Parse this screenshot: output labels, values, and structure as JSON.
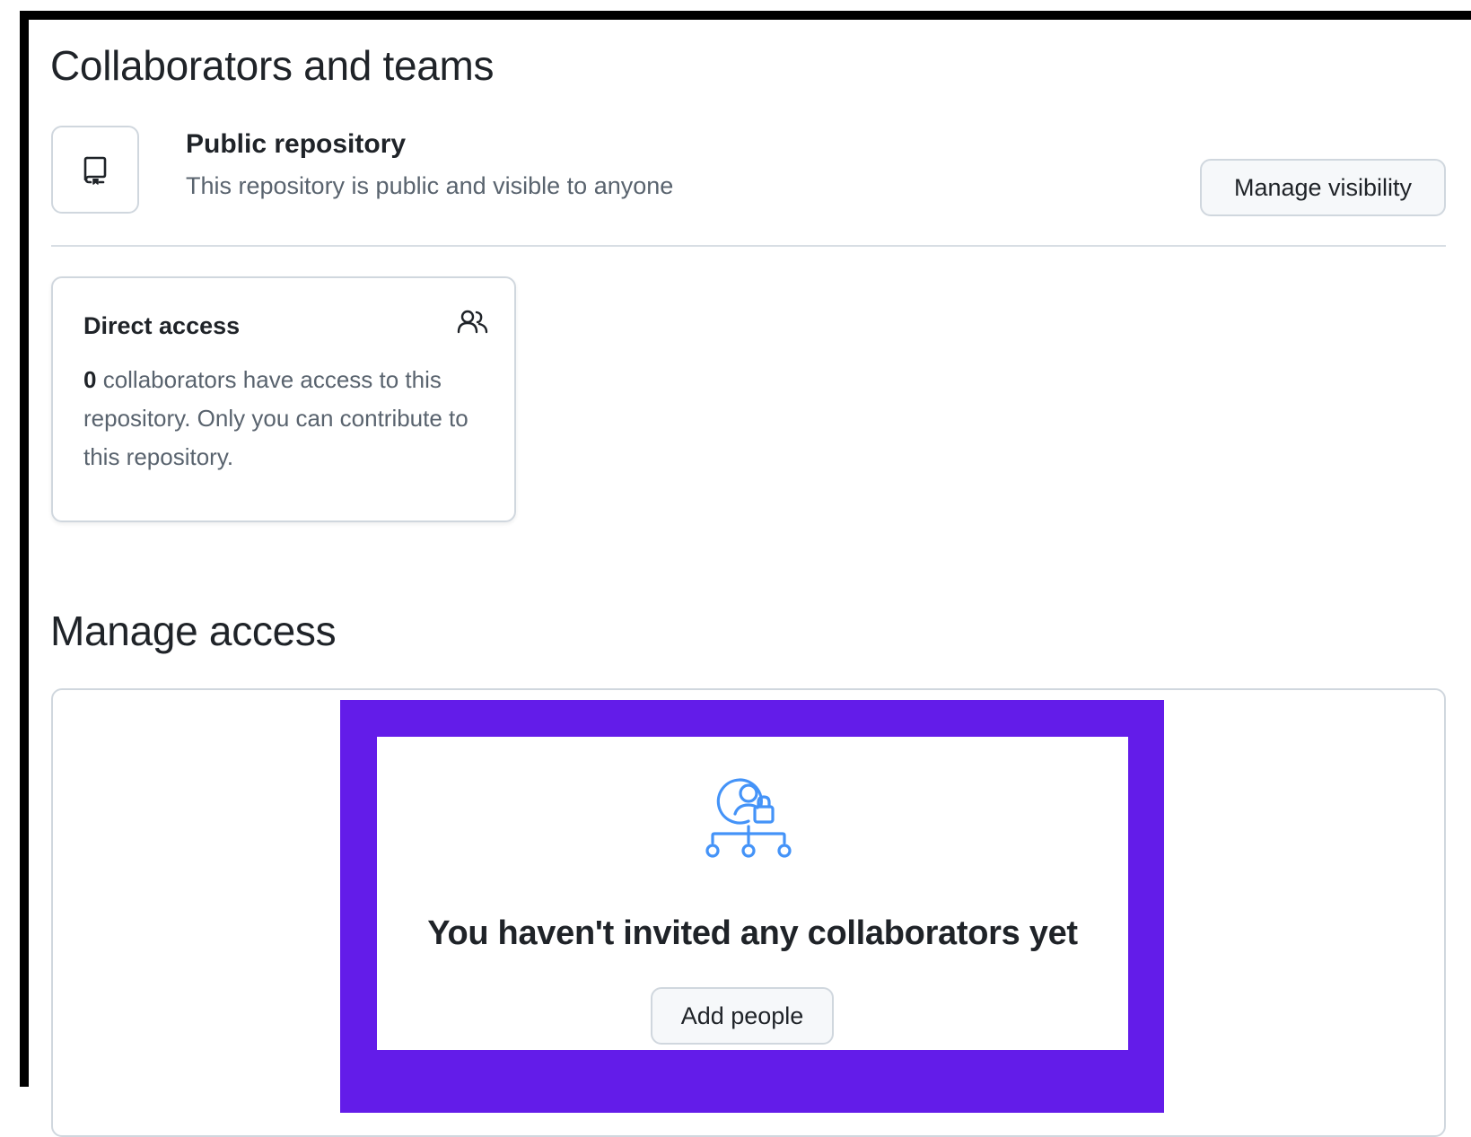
{
  "collaborators": {
    "title": "Collaborators and teams"
  },
  "visibility": {
    "title": "Public repository",
    "description": "This repository is public and visible to anyone",
    "button_label": "Manage visibility"
  },
  "direct_access": {
    "title": "Direct access",
    "count": "0",
    "text": " collaborators have access to this repository. Only you can contribute to this repository."
  },
  "manage_access": {
    "title": "Manage access",
    "empty_message": "You haven't invited any collaborators yet",
    "add_button_label": "Add people"
  },
  "icons": {
    "repo": "repo-icon",
    "people": "people-icon",
    "empty_state": "person-lock-tree-icon"
  },
  "colors": {
    "highlight": "#631ce9",
    "accent_blue": "#4493f8",
    "muted_text": "#59636e",
    "border": "#d0d7de"
  }
}
